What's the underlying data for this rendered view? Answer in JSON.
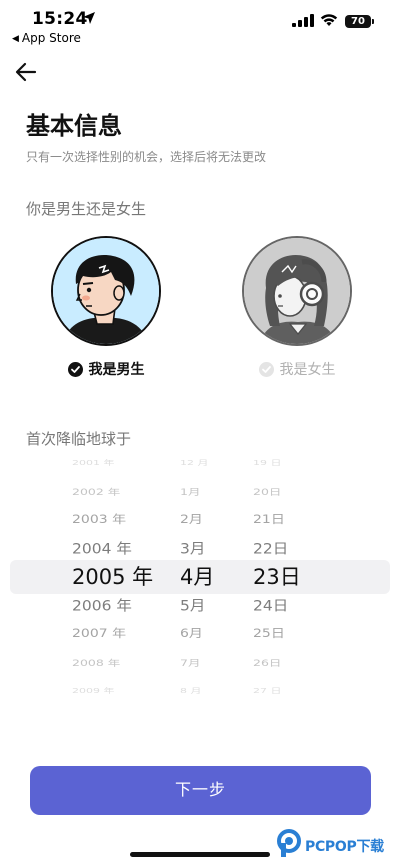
{
  "status_bar": {
    "time": "15:24",
    "back_app": "App Store",
    "battery": "70"
  },
  "page": {
    "title": "基本信息",
    "subtitle": "只有一次选择性别的机会，选择后将无法更改",
    "gender_section": "你是男生还是女生",
    "birth_section": "首次降临地球于"
  },
  "gender": {
    "options": [
      {
        "label": "我是男生",
        "selected": true
      },
      {
        "label": "我是女生",
        "selected": false
      }
    ]
  },
  "date_picker": {
    "rows": [
      {
        "year": "2001 年",
        "month": "12 月",
        "day": "19 日"
      },
      {
        "year": "2002 年",
        "month": "1月",
        "day": "20日"
      },
      {
        "year": "2003 年",
        "month": "2月",
        "day": "21日"
      },
      {
        "year": "2004 年",
        "month": "3月",
        "day": "22日"
      },
      {
        "year": "2005 年",
        "month": "4月",
        "day": "23日"
      },
      {
        "year": "2006 年",
        "month": "5月",
        "day": "24日"
      },
      {
        "year": "2007 年",
        "month": "6月",
        "day": "25日"
      },
      {
        "year": "2008 年",
        "month": "7月",
        "day": "26日"
      },
      {
        "year": "2009 年",
        "month": "8 月",
        "day": "27 日"
      }
    ],
    "selected": {
      "year": "2005 年",
      "month": "4月",
      "day": "23日"
    }
  },
  "actions": {
    "next_label": "下一步"
  },
  "watermark": {
    "text": "PCPOP下载"
  },
  "colors": {
    "accent": "#5b63d3",
    "watermark": "#2a7fd4"
  }
}
